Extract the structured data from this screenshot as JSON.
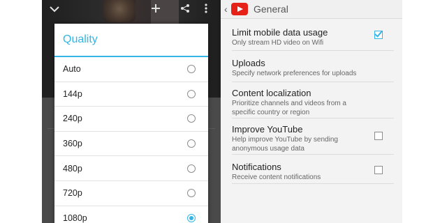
{
  "left": {
    "dialog": {
      "title": "Quality",
      "options": [
        {
          "label": "Auto",
          "selected": false
        },
        {
          "label": "144p",
          "selected": false
        },
        {
          "label": "240p",
          "selected": false
        },
        {
          "label": "360p",
          "selected": false
        },
        {
          "label": "480p",
          "selected": false
        },
        {
          "label": "720p",
          "selected": false
        },
        {
          "label": "1080p",
          "selected": true
        }
      ]
    },
    "top_icons": [
      "chevron-down-icon",
      "add-icon",
      "share-icon",
      "more-vert-icon"
    ]
  },
  "right": {
    "action_bar": {
      "title": "General",
      "logo": "youtube-logo"
    },
    "prefs": [
      {
        "title": "Limit mobile data usage",
        "summary": "Only stream HD video on Wifi",
        "checkbox": true,
        "checked": true
      },
      {
        "title": "Uploads",
        "summary": "Specify network preferences for uploads",
        "checkbox": false
      },
      {
        "title": "Content localization",
        "summary": "Prioritize channels and videos from a specific country or region",
        "checkbox": false
      },
      {
        "title": "Improve YouTube",
        "summary": "Help improve YouTube by sending anonymous usage data",
        "checkbox": true,
        "checked": false
      },
      {
        "title": "Notifications",
        "summary": "Receive content notifications",
        "checkbox": true,
        "checked": false
      }
    ]
  },
  "colors": {
    "accent": "#33b5e5",
    "youtube_red": "#e62117"
  }
}
